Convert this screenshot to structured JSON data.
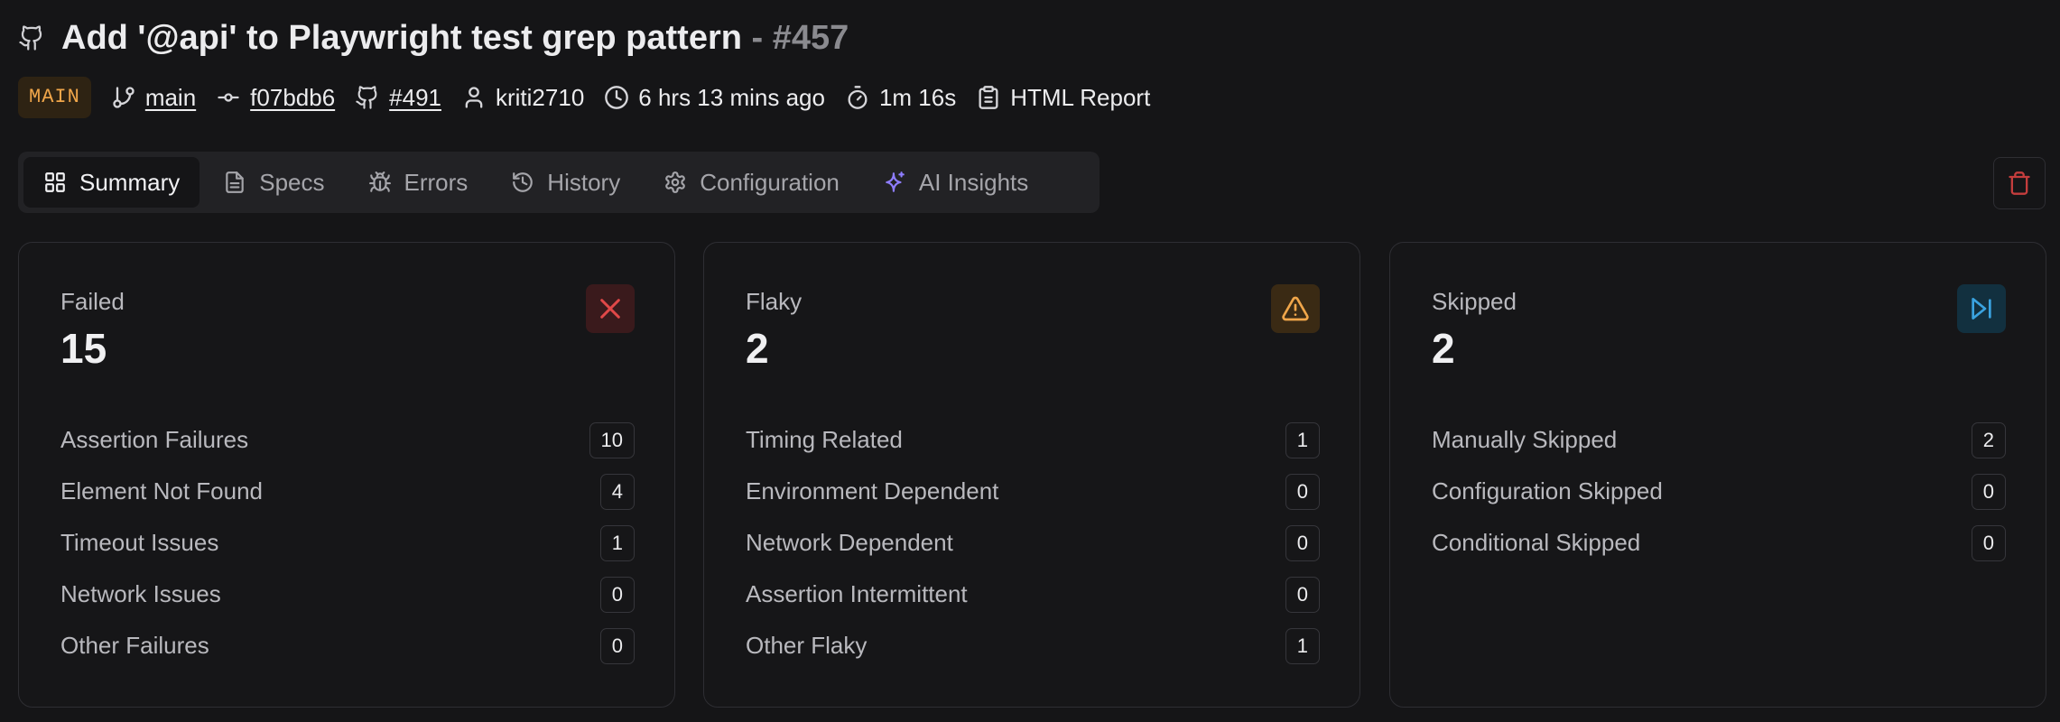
{
  "header": {
    "title": "Add '@api' to Playwright test grep pattern",
    "separator": " - ",
    "run_number": "#457"
  },
  "meta": {
    "branch_badge": "MAIN",
    "branch": "main",
    "commit": "f07bdb6",
    "pr": "#491",
    "author": "kriti2710",
    "time_ago": "6 hrs 13 mins ago",
    "duration": "1m 16s",
    "report": "HTML Report"
  },
  "tabs": [
    {
      "label": "Summary",
      "icon": "grid-icon",
      "active": true
    },
    {
      "label": "Specs",
      "icon": "file-icon"
    },
    {
      "label": "Errors",
      "icon": "bug-icon"
    },
    {
      "label": "History",
      "icon": "history-icon"
    },
    {
      "label": "Configuration",
      "icon": "gear-icon"
    },
    {
      "label": "AI Insights",
      "icon": "sparkle-icon"
    }
  ],
  "cards": {
    "failed": {
      "label": "Failed",
      "count": "15",
      "color": "#e04848",
      "rows": [
        {
          "label": "Assertion Failures",
          "value": "10"
        },
        {
          "label": "Element Not Found",
          "value": "4"
        },
        {
          "label": "Timeout Issues",
          "value": "1"
        },
        {
          "label": "Network Issues",
          "value": "0"
        },
        {
          "label": "Other Failures",
          "value": "0"
        }
      ]
    },
    "flaky": {
      "label": "Flaky",
      "count": "2",
      "color": "#f0a64a",
      "rows": [
        {
          "label": "Timing Related",
          "value": "1"
        },
        {
          "label": "Environment Dependent",
          "value": "0"
        },
        {
          "label": "Network Dependent",
          "value": "0"
        },
        {
          "label": "Assertion Intermittent",
          "value": "0"
        },
        {
          "label": "Other Flaky",
          "value": "1"
        }
      ]
    },
    "skipped": {
      "label": "Skipped",
      "count": "2",
      "color": "#3aa3e0",
      "rows": [
        {
          "label": "Manually Skipped",
          "value": "2"
        },
        {
          "label": "Configuration Skipped",
          "value": "0"
        },
        {
          "label": "Conditional Skipped",
          "value": "0"
        }
      ]
    }
  }
}
